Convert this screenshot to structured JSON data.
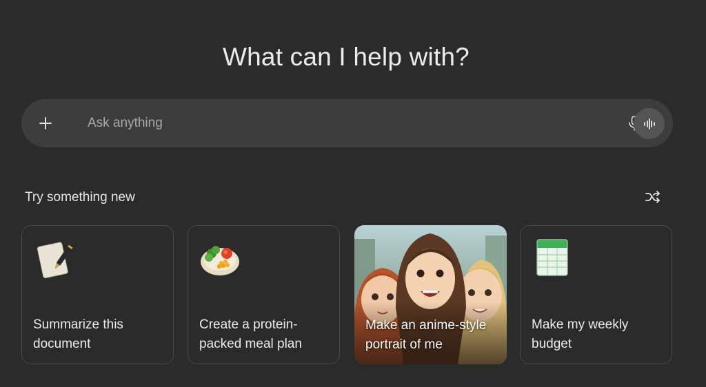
{
  "headline": "What can I help with?",
  "search": {
    "placeholder": "Ask anything",
    "icons": {
      "add": "plus-icon",
      "mic": "microphone-icon",
      "voice": "voice-waveform-icon"
    }
  },
  "suggestions": {
    "label": "Try something new",
    "shuffle_icon": "shuffle-icon",
    "cards": [
      {
        "text": "Summarize this\ndocument",
        "icon": "document-pen-icon"
      },
      {
        "text": "Create a protein-\npacked meal plan",
        "icon": "salad-plate-icon"
      },
      {
        "text": "Make an anime-style\nportrait of me",
        "icon": "anime-portrait-image"
      },
      {
        "text": "Make my weekly\nbudget",
        "icon": "spreadsheet-icon"
      }
    ]
  },
  "colors": {
    "background": "#2b2b2b",
    "search_bg": "#3d3d3d",
    "voice_btn_bg": "#545454",
    "card_border": "#4a4a4a"
  }
}
